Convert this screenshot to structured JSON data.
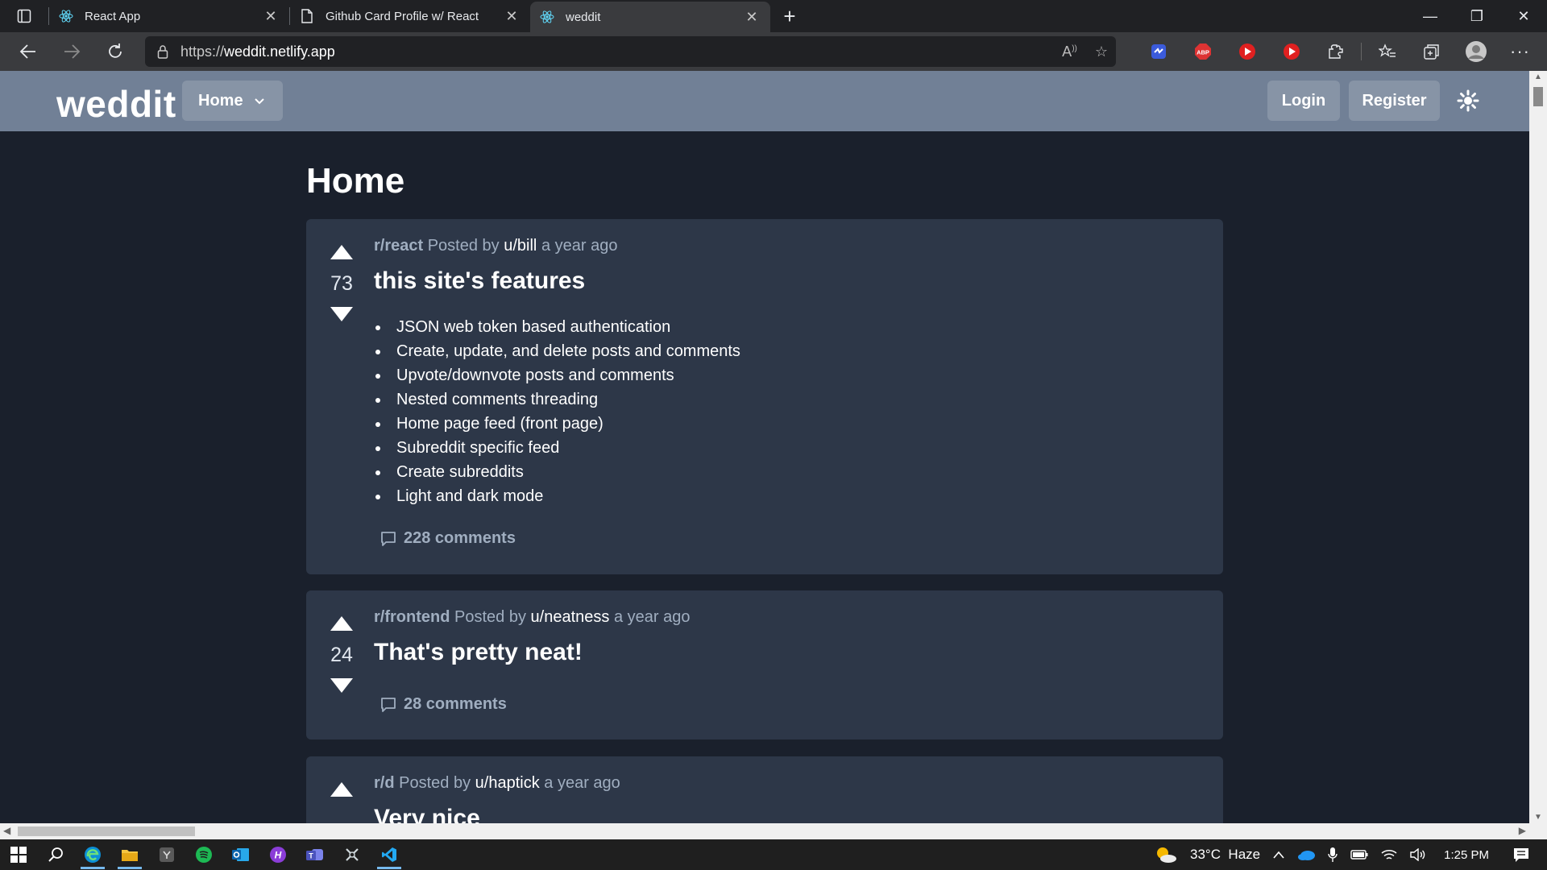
{
  "browser": {
    "tabs": [
      {
        "title": "React App",
        "icon": "react-icon",
        "active": false
      },
      {
        "title": "Github Card Profile w/ React",
        "icon": "page-icon",
        "active": false
      },
      {
        "title": "weddit",
        "icon": "react-icon",
        "active": true
      }
    ],
    "url_prefix": "https://",
    "url_host": "weddit.netlify.app"
  },
  "site": {
    "brand": "weddit",
    "nav_menu": "Home",
    "login": "Login",
    "register": "Register"
  },
  "page": {
    "title": "Home"
  },
  "posts": [
    {
      "subreddit": "r/react",
      "posted_by": "Posted by",
      "user": "u/bill",
      "time": "a year ago",
      "score": "73",
      "title": "this site's features",
      "items": [
        "JSON web token based authentication",
        "Create, update, and delete posts and comments",
        "Upvote/downvote posts and comments",
        "Nested comments threading",
        "Home page feed (front page)",
        "Subreddit specific feed",
        "Create subreddits",
        "Light and dark mode"
      ],
      "comments": "228 comments"
    },
    {
      "subreddit": "r/frontend",
      "posted_by": "Posted by",
      "user": "u/neatness",
      "time": "a year ago",
      "score": "24",
      "title": "That's pretty neat!",
      "comments": "28 comments"
    },
    {
      "subreddit": "r/d",
      "posted_by": "Posted by",
      "user": "u/haptick",
      "time": "a year ago",
      "score": "",
      "title": "Very nice"
    }
  ],
  "taskbar": {
    "weather": "33°C  Haze",
    "time": "1:25 PM"
  },
  "colors": {
    "page_bg": "#1a202c",
    "navbar_bg": "#718096",
    "card_bg": "#2d3748",
    "muted_text": "#a0aec0"
  }
}
